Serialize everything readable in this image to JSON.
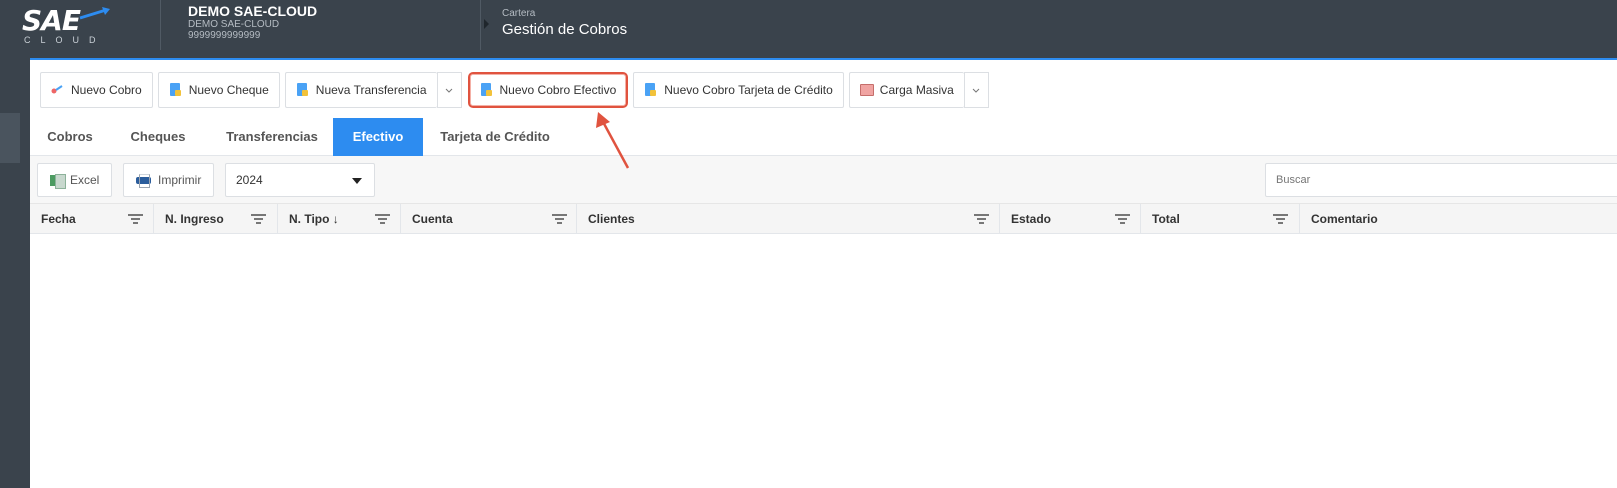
{
  "header": {
    "logo_text": "SAE",
    "logo_sub": "CLOUD",
    "company_name": "DEMO SAE-CLOUD",
    "company_sub": "DEMO SAE-CLOUD",
    "company_id": "9999999999999",
    "breadcrumb_parent": "Cartera",
    "page_title": "Gestión de Cobros"
  },
  "toolbar": {
    "nuevo_cobro": "Nuevo Cobro",
    "nuevo_cheque": "Nuevo Cheque",
    "nueva_transferencia": "Nueva Transferencia",
    "nuevo_cobro_efectivo": "Nuevo Cobro Efectivo",
    "nuevo_cobro_tarjeta": "Nuevo Cobro Tarjeta de Crédito",
    "carga_masiva": "Carga Masiva"
  },
  "tabs": [
    {
      "label": "Cobros",
      "active": false
    },
    {
      "label": "Cheques",
      "active": false
    },
    {
      "label": "Transferencias",
      "active": false
    },
    {
      "label": "Efectivo",
      "active": true
    },
    {
      "label": "Tarjeta de Crédito",
      "active": false
    }
  ],
  "grid": {
    "excel_label": "Excel",
    "print_label": "Imprimir",
    "year_selected": "2024",
    "search_placeholder": "Buscar",
    "columns": [
      "Fecha",
      "N. Ingreso",
      "N. Tipo ↓",
      "Cuenta",
      "Clientes",
      "Estado",
      "Total",
      "Comentario"
    ]
  },
  "colors": {
    "accent": "#2d8cf0",
    "header_bg": "#3a434c",
    "highlight": "#e0533f"
  }
}
